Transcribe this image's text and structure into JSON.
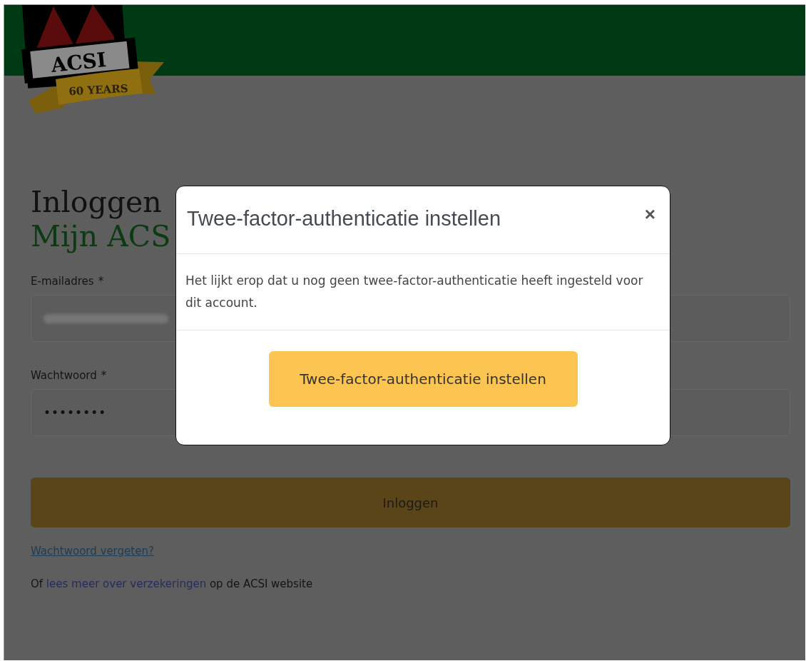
{
  "header": {
    "logo": {
      "wordmark": "ACSI",
      "badge": "60 YEARS"
    }
  },
  "login": {
    "title": "Inloggen",
    "subtitle": "Mijn ACS",
    "fields": [
      {
        "kind": "email",
        "label": "E-mailadres",
        "required_mark": "*"
      },
      {
        "kind": "password",
        "label": "Wachtwoord",
        "required_mark": "*",
        "value": "••••••••"
      }
    ],
    "submit": "Inloggen",
    "forgot_link": "Wachtwoord vergeten?",
    "footer": {
      "prefix": "Of",
      "link": "lees meer over verzekeringen",
      "suffix": "op de ACSI website"
    }
  },
  "modal": {
    "title": "Twee-factor-authenticatie instellen",
    "close": "×",
    "message": "Het lijkt erop dat u nog geen twee-factor-authenticatie heeft ingesteld voor dit account.",
    "button": "Twee-factor-authenticatie instellen"
  }
}
